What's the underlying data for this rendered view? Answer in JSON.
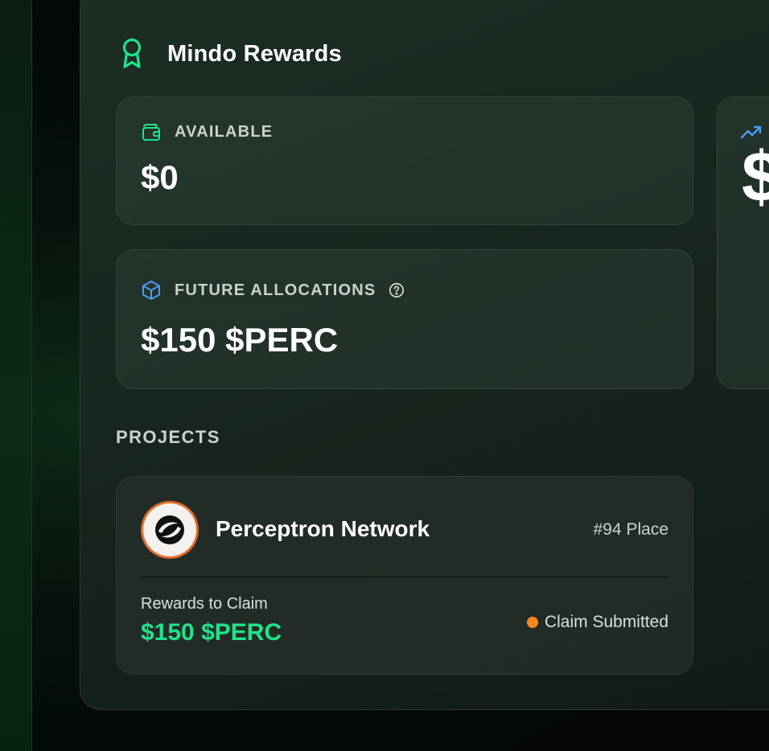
{
  "colors": {
    "accent_green": "#1fe38a",
    "accent_blue": "#4b9cf5",
    "status_orange": "#f5891f",
    "avatar_ring": "#e06b2c"
  },
  "header": {
    "icon": "award-ribbon-icon",
    "title": "Mindo Rewards"
  },
  "stats": {
    "available": {
      "icon": "wallet-icon",
      "label": "AVAILABLE",
      "value": "$0"
    },
    "future": {
      "icon": "cube-icon",
      "label": "FUTURE ALLOCATIONS",
      "help_icon": "help-circle-icon",
      "value": "$150 $PERC"
    },
    "side": {
      "icon": "trending-up-icon",
      "value": "$"
    }
  },
  "projects": {
    "section_label": "PROJECTS",
    "items": [
      {
        "name": "Perceptron Network",
        "place": "#94 Place",
        "rewards_label": "Rewards to Claim",
        "rewards_value": "$150 $PERC",
        "status": "Claim Submitted"
      }
    ]
  }
}
